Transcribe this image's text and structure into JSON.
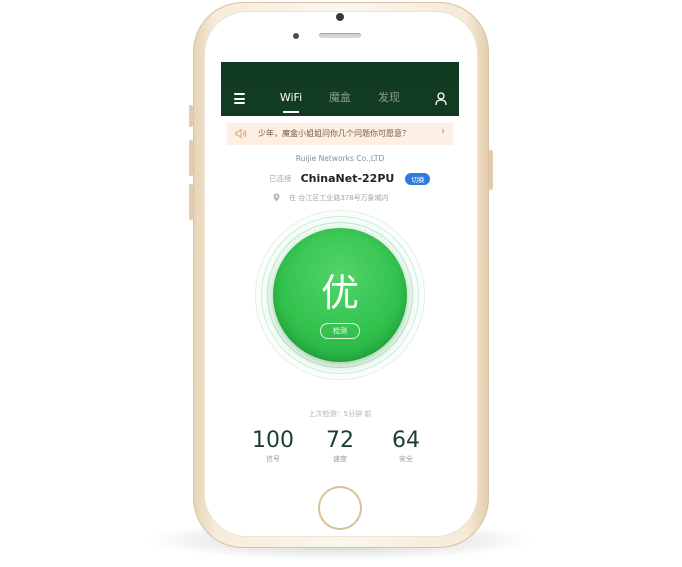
{
  "nav": {
    "tabs": [
      {
        "label": "WiFi",
        "active": true
      },
      {
        "label": "魔盒",
        "active": false
      },
      {
        "label": "发现",
        "active": false
      }
    ],
    "menu_icon": "hamburger-icon",
    "user_icon": "user-icon"
  },
  "notice": {
    "text": "少年，魔盒小姐姐问你几个问题你可愿意？",
    "icon": "speaker-icon"
  },
  "network": {
    "company": "Ruijie Networks Co.,LTD",
    "connected_label": "已连接",
    "ssid": "ChinaNet-22PU",
    "switch_label": "切换",
    "location": "在 台江区工业路378号万象城内"
  },
  "status": {
    "grade": "优",
    "detect_label": "检测",
    "last_check": "上次检测：5分钟 前"
  },
  "metrics": [
    {
      "value": "100",
      "label": "信号"
    },
    {
      "value": "72",
      "label": "速度"
    },
    {
      "value": "64",
      "label": "安全"
    }
  ],
  "colors": {
    "navbar": "#113b22",
    "score_green": "#33c24e",
    "switch_blue": "#2f7ae0",
    "phone_gold": "#f3e6d2"
  }
}
